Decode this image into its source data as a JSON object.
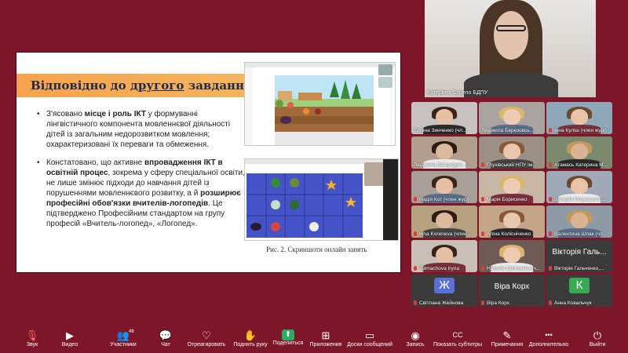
{
  "slide": {
    "title_pre": "Відповідно до ",
    "title_underlined": "другого",
    "title_post": " завдання:",
    "bullet1": {
      "t1": "З'ясовано ",
      "b1": "місце і роль ІКТ",
      "t2": " у формуванні лінгвістичного компонента мовленнєвої діяльності дітей із загальним недорозвитком мовлення; охарактеризовані їх переваги та обмеження."
    },
    "bullet2": {
      "t1": "Констатовано, що активне ",
      "b1": "впровадження ІКТ в освітній процес",
      "t2": ", зокрема у сферу спеціальної освіти, не лише змінює підходи до навчання дітей із порушеннями мовленнєвого розвитку, а й ",
      "b2": "розширює професійні обов'язки вчителів-логопедів",
      "t3": ". Це підтверджено Професійним стандартом на групу професій «Вчитель-логопед», «Логопед»."
    },
    "caption": "Рис. 2. Скриншоти онлайн занять"
  },
  "speaker": {
    "name": "Катерина Сурело БДПУ"
  },
  "participants": [
    {
      "name": "Тетяна Зинченко (чл...",
      "muted": false
    },
    {
      "name": "Людмила Березовсь...",
      "muted": false
    },
    {
      "name": "Інна Куліш (член журі)",
      "muted": true
    },
    {
      "name": "Людмила Загороднє...",
      "muted": false
    },
    {
      "name": "Глухівський НПУ ім....",
      "muted": true
    },
    {
      "name": "Атамась Катерина М...",
      "muted": true
    },
    {
      "name": "Надія Кот (член журі)",
      "muted": true
    },
    {
      "name": "Марія Борисенко",
      "muted": true
    },
    {
      "name": "Валерія Гогунська Б...",
      "muted": true
    },
    {
      "name": "Inna Koreneva (член ...",
      "muted": true
    },
    {
      "name": "Аліна Колісніченко",
      "muted": true
    },
    {
      "name": "Валентина Шпак (чл...",
      "muted": true
    },
    {
      "name": "Tolmachova Iryna",
      "muted": true
    },
    {
      "name": "Наталія Світлична (ч...",
      "muted": true
    },
    {
      "name": "Вікторія Гальченко,...",
      "muted": true,
      "big_label": "Вікторія Галь..."
    },
    {
      "name": "Світлана Жейнова",
      "muted": true,
      "initial": "Ж",
      "color": "#5b6fd6"
    },
    {
      "name": "Віра Корх",
      "muted": true,
      "big_label": "Віра Корх"
    },
    {
      "name": "Анна Ковальчук",
      "muted": true,
      "initial": "К",
      "color": "#3aaa52"
    }
  ],
  "toolbar": {
    "items": [
      {
        "label": "Звук",
        "icon": "mic-icon"
      },
      {
        "label": "Видео",
        "icon": "video-icon"
      },
      {
        "label": "Участники",
        "icon": "participants-icon",
        "count": "46"
      },
      {
        "label": "Чат",
        "icon": "chat-icon"
      },
      {
        "label": "Отреагировать",
        "icon": "heart-icon"
      },
      {
        "label": "Поднять руку",
        "icon": "hand-icon"
      },
      {
        "label": "Поделиться",
        "icon": "share-icon"
      },
      {
        "label": "Приложения",
        "icon": "apps-icon"
      },
      {
        "label": "Доски сообщений",
        "icon": "whiteboard-icon"
      },
      {
        "label": "Запись",
        "icon": "record-icon"
      },
      {
        "label": "Показать субтитры",
        "icon": "cc-icon"
      },
      {
        "label": "Примечания",
        "icon": "notes-icon"
      },
      {
        "label": "Дополнительно",
        "icon": "more-icon"
      },
      {
        "label": "Выйти",
        "icon": "leave-icon"
      }
    ]
  },
  "colors": {
    "bg": "#7d1629",
    "accent": "#f6a24c",
    "mute": "#e23a3a",
    "share": "#27ae60"
  }
}
